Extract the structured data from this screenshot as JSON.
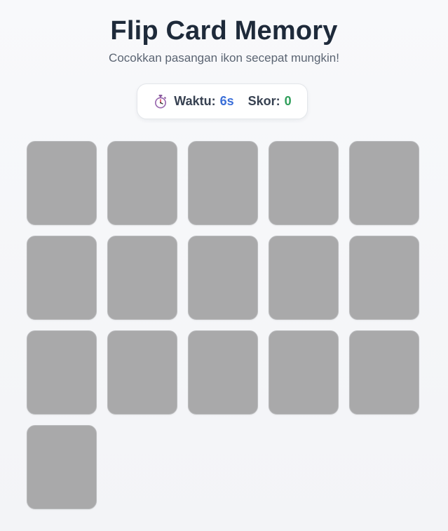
{
  "header": {
    "title": "Flip Card Memory",
    "subtitle": "Cocokkan pasangan ikon secepat mungkin!"
  },
  "stats": {
    "timer_icon": "stopwatch-icon",
    "time_label": "Waktu:",
    "time_value": "6s",
    "score_label": "Skor:",
    "score_value": "0"
  },
  "colors": {
    "title": "#1e2a3a",
    "time_value": "#3b6fd8",
    "score_value": "#2f9e5a",
    "card_back": "#a9a9aa"
  },
  "board": {
    "columns": 5,
    "cards": [
      {
        "state": "face-down"
      },
      {
        "state": "face-down"
      },
      {
        "state": "face-down"
      },
      {
        "state": "face-down"
      },
      {
        "state": "face-down"
      },
      {
        "state": "face-down"
      },
      {
        "state": "face-down"
      },
      {
        "state": "face-down"
      },
      {
        "state": "face-down"
      },
      {
        "state": "face-down"
      },
      {
        "state": "face-down"
      },
      {
        "state": "face-down"
      },
      {
        "state": "face-down"
      },
      {
        "state": "face-down"
      },
      {
        "state": "face-down"
      },
      {
        "state": "face-down"
      }
    ]
  }
}
